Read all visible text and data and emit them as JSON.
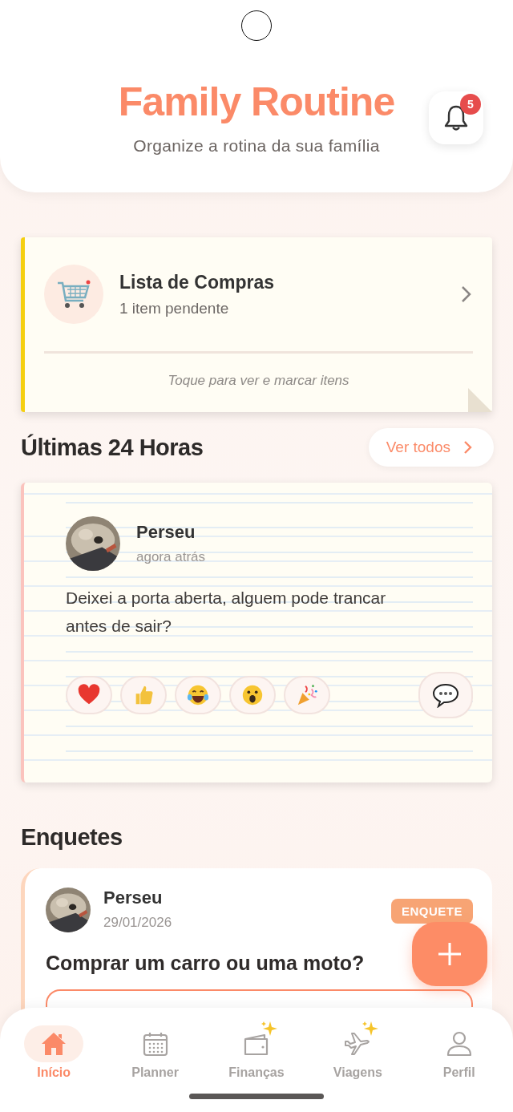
{
  "header": {
    "title": "Family Routine",
    "subtitle": "Organize a rotina da sua família",
    "notifications": "5"
  },
  "shopping_card": {
    "title": "Lista de Compras",
    "subtitle": "1 item pendente",
    "hint": "Toque para ver e marcar itens"
  },
  "recent": {
    "title": "Últimas 24 Horas",
    "see_all": "Ver todos",
    "post": {
      "author": "Perseu",
      "time": "agora atrás",
      "text": "Deixei a porta aberta, alguem pode trancar antes de sair?",
      "reactions": [
        {
          "kind": "heart"
        },
        {
          "kind": "thumbs"
        },
        {
          "kind": "laugh"
        },
        {
          "kind": "wow"
        },
        {
          "kind": "party"
        }
      ]
    }
  },
  "polls": {
    "title": "Enquetes",
    "poll": {
      "author": "Perseu",
      "date": "29/01/2026",
      "badge": "ENQUETE",
      "question": "Comprar um carro ou uma moto?"
    }
  },
  "nav": [
    {
      "kind": "home",
      "label": "Início",
      "selected": true,
      "sparkle": false
    },
    {
      "kind": "calendar",
      "label": "Planner",
      "selected": false,
      "sparkle": false
    },
    {
      "kind": "wallet",
      "label": "Finanças",
      "selected": false,
      "sparkle": true
    },
    {
      "kind": "plane",
      "label": "Viagens",
      "selected": false,
      "sparkle": true
    },
    {
      "kind": "person",
      "label": "Perfil",
      "selected": false,
      "sparkle": false
    }
  ]
}
